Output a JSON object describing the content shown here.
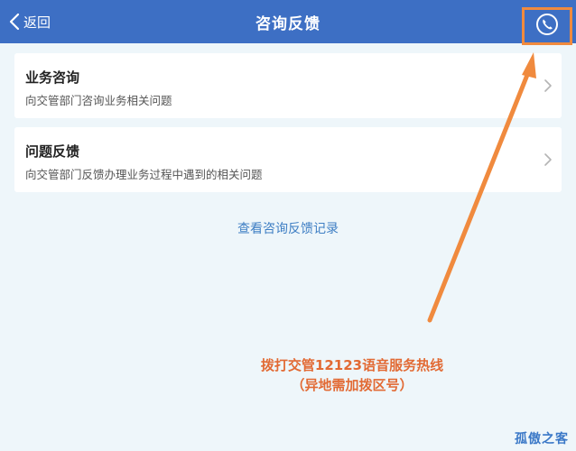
{
  "header": {
    "back_label": "返回",
    "title": "咨询反馈",
    "phone_icon": "phone-icon"
  },
  "items": [
    {
      "title": "业务咨询",
      "description": "向交管部门咨询业务相关问题"
    },
    {
      "title": "问题反馈",
      "description": "向交管部门反馈办理业务过程中遇到的相关问题"
    }
  ],
  "history_link": "查看咨询反馈记录",
  "annotation": {
    "line1": "拨打交管12123语音服务热线",
    "line2": "（异地需加拨区号）"
  },
  "watermark": "孤傲之客",
  "colors": {
    "header_bg": "#3d6fc4",
    "background": "#eef6fa",
    "link": "#3f7fc4",
    "annotation": "#e26a34"
  }
}
